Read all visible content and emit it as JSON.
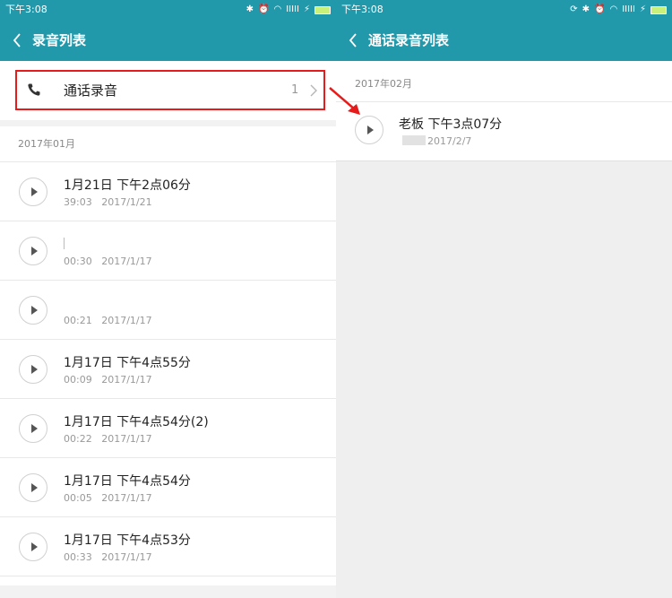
{
  "left": {
    "status": {
      "time": "下午3:08",
      "signal": "IIIII"
    },
    "title": "录音列表",
    "call_entry": {
      "label": "通话录音",
      "count": "1"
    },
    "sections": [
      {
        "header": "2017年01月",
        "items": [
          {
            "name": "1月21日 下午2点06分",
            "duration": "39:03",
            "date": "2017/1/21"
          },
          {
            "name": "",
            "duration": "00:30",
            "date": "2017/1/17"
          },
          {
            "name": "",
            "duration": "00:21",
            "date": "2017/1/17"
          },
          {
            "name": "1月17日 下午4点55分",
            "duration": "00:09",
            "date": "2017/1/17"
          },
          {
            "name": "1月17日 下午4点54分(2)",
            "duration": "00:22",
            "date": "2017/1/17"
          },
          {
            "name": "1月17日 下午4点54分",
            "duration": "00:05",
            "date": "2017/1/17"
          },
          {
            "name": "1月17日 下午4点53分",
            "duration": "00:33",
            "date": "2017/1/17"
          }
        ]
      }
    ]
  },
  "right": {
    "status": {
      "time": "下午3:08",
      "signal": "IIIII"
    },
    "title": "通话录音列表",
    "section_header": "2017年02月",
    "item": {
      "name": "老板 下午3点07分",
      "date": "2017/2/7"
    }
  },
  "colors": {
    "accent": "#2298ab",
    "highlight": "#e61b1b"
  },
  "icons": [
    "back-icon",
    "phone-icon",
    "chevron-right-icon",
    "play-icon",
    "bluetooth-icon",
    "alarm-icon",
    "wifi-icon",
    "battery-icon",
    "sync-icon"
  ]
}
